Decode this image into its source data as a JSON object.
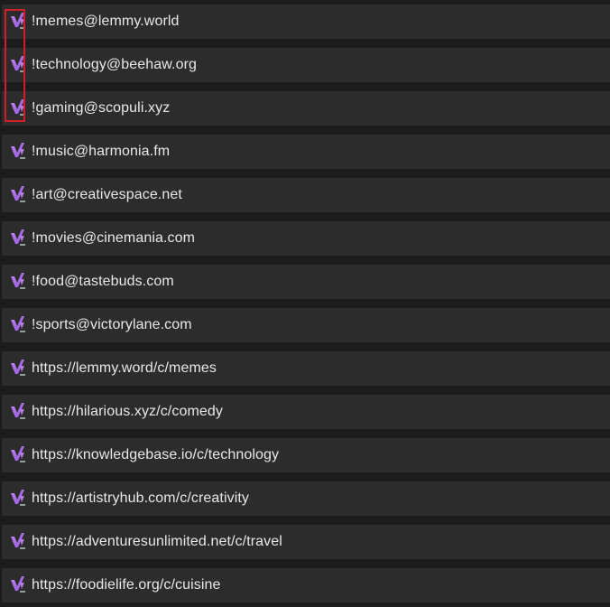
{
  "communities": [
    {
      "label": "!memes@lemmy.world",
      "icon": "lemmy-logo-icon"
    },
    {
      "label": "!technology@beehaw.org",
      "icon": "lemmy-logo-icon"
    },
    {
      "label": "!gaming@scopuli.xyz",
      "icon": "lemmy-logo-icon"
    },
    {
      "label": "!music@harmonia.fm",
      "icon": "lemmy-logo-icon"
    },
    {
      "label": "!art@creativespace.net",
      "icon": "lemmy-logo-icon"
    },
    {
      "label": "!movies@cinemania.com",
      "icon": "lemmy-logo-icon"
    },
    {
      "label": "!food@tastebuds.com",
      "icon": "lemmy-logo-icon"
    },
    {
      "label": "!sports@victorylane.com",
      "icon": "lemmy-logo-icon"
    },
    {
      "label": "https://lemmy.word/c/memes",
      "icon": "lemmy-logo-icon"
    },
    {
      "label": "https://hilarious.xyz/c/comedy",
      "icon": "lemmy-logo-icon"
    },
    {
      "label": "https://knowledgebase.io/c/technology",
      "icon": "lemmy-logo-icon"
    },
    {
      "label": "https://artistryhub.com/c/creativity",
      "icon": "lemmy-logo-icon"
    },
    {
      "label": "https://adventuresunlimited.net/c/travel",
      "icon": "lemmy-logo-icon"
    },
    {
      "label": "https://foodielife.org/c/cuisine",
      "icon": "lemmy-logo-icon"
    }
  ],
  "colors": {
    "row_background": "#2c2c2c",
    "page_background": "#1b1b1b",
    "text": "#e8e8e8",
    "icon_gradient_start": "#c58cf5",
    "icon_gradient_end": "#8f4fe0",
    "highlight_border": "#d21f27"
  },
  "highlight": {
    "covers_rows": [
      0,
      1,
      2
    ]
  }
}
